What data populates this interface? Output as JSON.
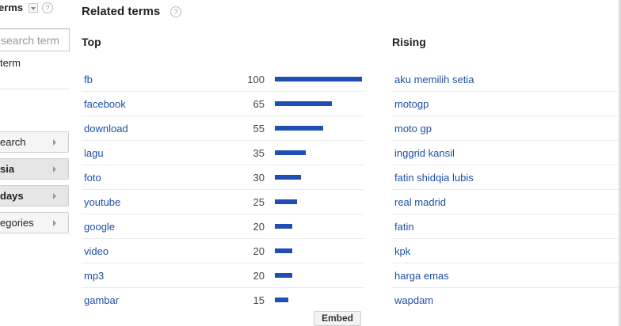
{
  "left_panel": {
    "title": "erms",
    "help": "?",
    "search_placeholder": "search term",
    "term_label": "term",
    "buttons": [
      {
        "label": "earch",
        "style": "light"
      },
      {
        "label": "sia",
        "style": "dark"
      },
      {
        "label": "days",
        "style": "dark"
      },
      {
        "label": "egories",
        "style": "light"
      }
    ]
  },
  "related": {
    "title": "Related terms",
    "help": "?",
    "top_header": "Top",
    "rising_header": "Rising",
    "embed_label": "Embed",
    "bar_color": "#1f4fb4",
    "link_color": "#1d4fa4",
    "top": [
      {
        "term": "fb",
        "value": 100
      },
      {
        "term": "facebook",
        "value": 65
      },
      {
        "term": "download",
        "value": 55
      },
      {
        "term": "lagu",
        "value": 35
      },
      {
        "term": "foto",
        "value": 30
      },
      {
        "term": "youtube",
        "value": 25
      },
      {
        "term": "google",
        "value": 20
      },
      {
        "term": "video",
        "value": 20
      },
      {
        "term": "mp3",
        "value": 20
      },
      {
        "term": "gambar",
        "value": 15
      }
    ],
    "rising": [
      {
        "term": "aku memilih setia"
      },
      {
        "term": "motogp"
      },
      {
        "term": "moto gp"
      },
      {
        "term": "inggrid kansil"
      },
      {
        "term": "fatin shidqia lubis"
      },
      {
        "term": "real madrid"
      },
      {
        "term": "fatin"
      },
      {
        "term": "kpk"
      },
      {
        "term": "harga emas"
      },
      {
        "term": "wapdam"
      }
    ]
  }
}
